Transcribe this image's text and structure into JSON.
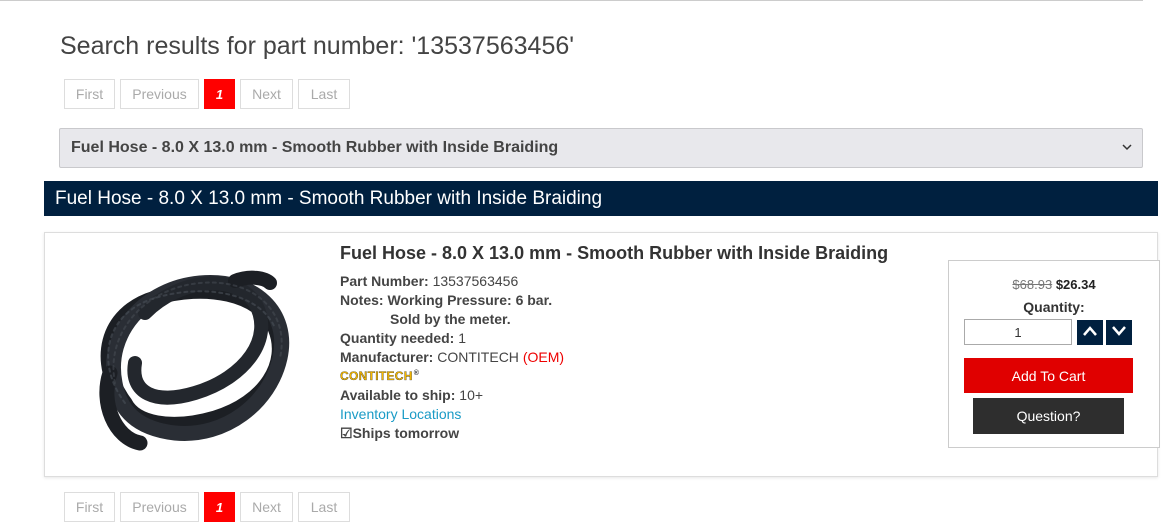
{
  "search": {
    "title": "Search results for part number: '13537563456'"
  },
  "pagination": {
    "first": "First",
    "previous": "Previous",
    "current": "1",
    "next": "Next",
    "last": "Last"
  },
  "selector": {
    "selected": "Fuel Hose - 8.0 X 13.0 mm - Smooth Rubber with Inside Braiding"
  },
  "section": {
    "title": "Fuel Hose - 8.0 X 13.0 mm - Smooth Rubber with Inside Braiding"
  },
  "product": {
    "title": "Fuel Hose - 8.0 X 13.0 mm - Smooth Rubber with Inside Braiding",
    "part_number_label": "Part Number:",
    "part_number": "13537563456",
    "notes_label": "Notes:",
    "notes_line1": "Working Pressure: 6 bar.",
    "notes_line2": "Sold by the meter.",
    "qty_needed_label": "Quantity needed:",
    "qty_needed": "1",
    "manufacturer_label": "Manufacturer:",
    "manufacturer": "CONTITECH",
    "oem": "(OEM)",
    "brand_logo_text": "CONTITECH",
    "brand_logo_mark": "®",
    "available_label": "Available to ship:",
    "available": "10+",
    "inventory_link": "Inventory Locations",
    "ships_checkbox": "☑",
    "ships": "Ships tomorrow"
  },
  "cart": {
    "old_price": "$68.93",
    "price": "$26.34",
    "quantity_label": "Quantity:",
    "quantity_value": "1",
    "add_to_cart": "Add To Cart",
    "question": "Question?"
  },
  "colors": {
    "navy": "#00203f",
    "red": "#e00000",
    "link": "#1a9bc6",
    "dark_button": "#2e2e2e"
  },
  "icons": {
    "step_up": "chevron-up-icon",
    "step_down": "chevron-down-icon",
    "select_arrow": "chevron-down-icon"
  }
}
